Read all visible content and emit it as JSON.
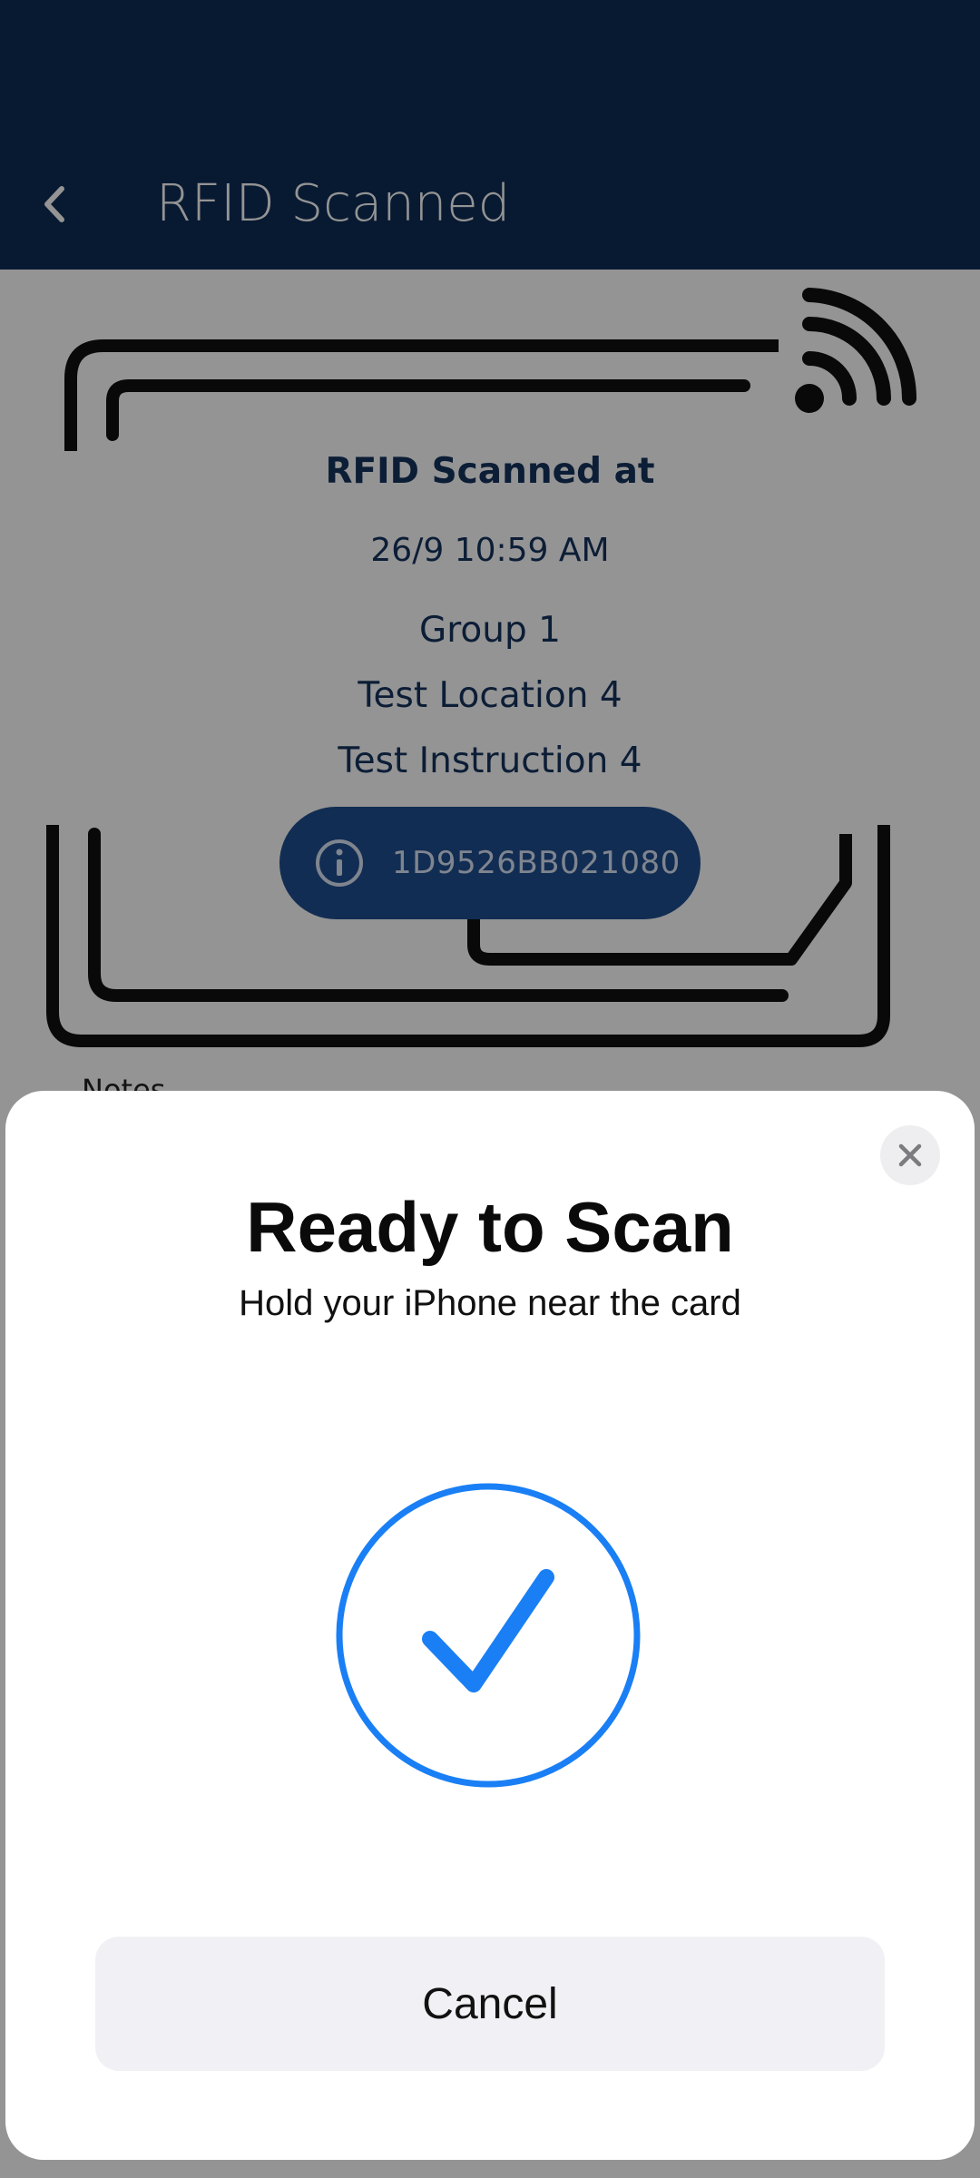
{
  "header": {
    "title": "RFID Scanned",
    "back_icon": "chevron-left-icon"
  },
  "scan_info": {
    "heading": "RFID Scanned at",
    "timestamp": "26/9 10:59 AM",
    "group": "Group 1",
    "location": "Test Location 4",
    "instruction": "Test Instruction 4",
    "tag_id": "1D9526BB021080",
    "info_icon": "info-icon"
  },
  "notes": {
    "label": "Notes"
  },
  "nfc_sheet": {
    "title": "Ready to Scan",
    "subtitle": "Hold your iPhone near the card",
    "close_icon": "close-icon",
    "status_icon": "checkmark-circle-icon",
    "cancel_label": "Cancel"
  },
  "colors": {
    "header_bg": "#0e2d57",
    "primary_text": "#16335e",
    "pill_bg": "#1f4f8f",
    "accent_blue": "#1a7ff5"
  }
}
